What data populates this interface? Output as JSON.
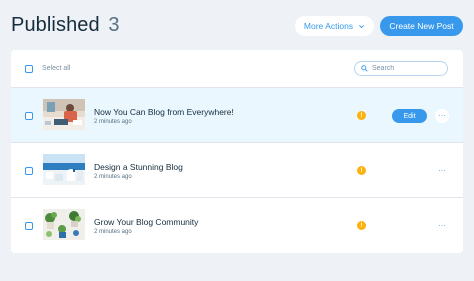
{
  "header": {
    "title": "Published",
    "count": "3",
    "more_actions_label": "More Actions",
    "create_label": "Create New Post"
  },
  "toolbar": {
    "select_all_label": "Select all",
    "search_placeholder": "Search"
  },
  "posts": [
    {
      "title": "Now You Can Blog from Everywhere!",
      "time": "2 minutes ago",
      "status_icon": "warning-icon",
      "thumbnail": "person-at-desk-image",
      "hovered": true,
      "edit_label": "Edit",
      "more_label": "···"
    },
    {
      "title": "Design a Stunning Blog",
      "time": "2 minutes ago",
      "status_icon": "warning-icon",
      "thumbnail": "seaside-town-image",
      "more_label": "···"
    },
    {
      "title": "Grow Your Blog Community",
      "time": "2 minutes ago",
      "status_icon": "warning-icon",
      "thumbnail": "plants-image",
      "more_label": "···"
    }
  ],
  "status_icon_glyph": "!",
  "colors": {
    "accent": "#3899ec",
    "warning": "#fdb10c",
    "background": "#eef1f5",
    "highlight": "#eaf7ff"
  }
}
